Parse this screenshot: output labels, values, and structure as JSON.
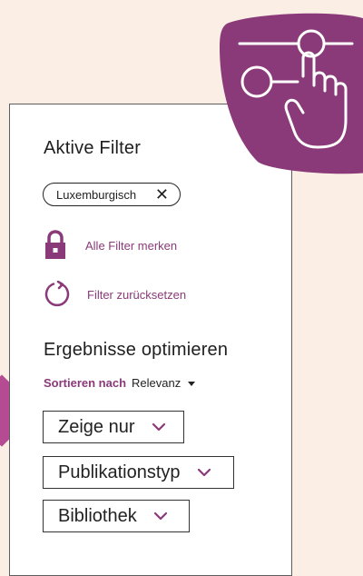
{
  "active_filters": {
    "title": "Aktive Filter",
    "chips": [
      {
        "label": "Luxemburgisch"
      }
    ],
    "save_label": "Alle Filter merken",
    "reset_label": "Filter zurücksetzen"
  },
  "refine": {
    "title": "Ergebnisse optimieren",
    "sort": {
      "label": "Sortieren nach",
      "value": "Relevanz"
    },
    "dropdowns": [
      {
        "label": "Zeige nur"
      },
      {
        "label": "Publikationstyp"
      },
      {
        "label": "Bibliothek"
      }
    ]
  },
  "colors": {
    "accent": "#8a3a78",
    "background": "#faeee5",
    "blob": "#8a3a78",
    "left_accent": "#b54b93"
  },
  "icons": [
    "filter-slider-hand-icon",
    "lock-icon",
    "reset-icon",
    "close-icon",
    "caret-down-icon",
    "chevron-down-icon"
  ]
}
